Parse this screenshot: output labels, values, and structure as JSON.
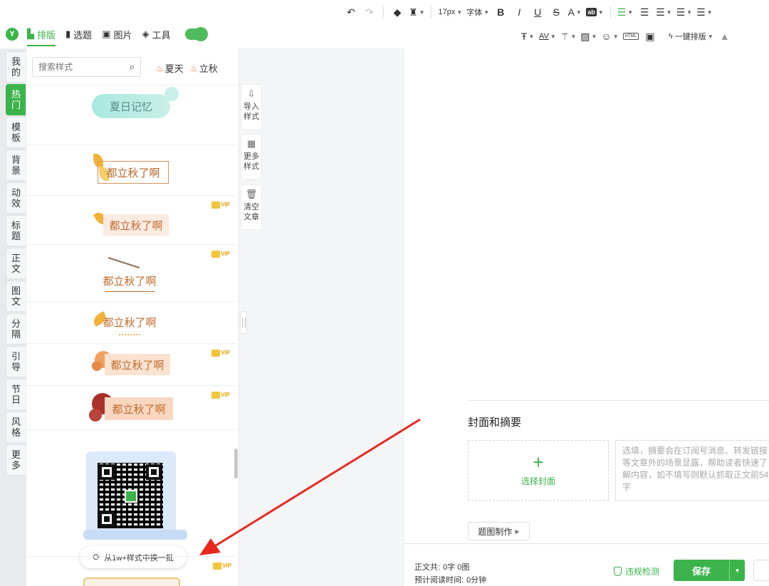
{
  "toolbar": {
    "font_size": "17px",
    "font_label": "字体",
    "bold": "B",
    "italic": "I",
    "underline": "U",
    "strike": "S",
    "color": "A",
    "highlight": "ab",
    "letter_spacing": "AV",
    "html_label": "HTML",
    "one_key_layout": "一键排版"
  },
  "nav": {
    "logo": "Y",
    "items": [
      {
        "label": "排版",
        "icon": "layout-icon"
      },
      {
        "label": "选题",
        "icon": "bookmark-icon"
      },
      {
        "label": "图片",
        "icon": "image-icon"
      },
      {
        "label": "工具",
        "icon": "cube-icon"
      }
    ]
  },
  "categories": [
    {
      "l1": "我",
      "l2": "的"
    },
    {
      "l1": "热",
      "l2": "门"
    },
    {
      "l1": "模",
      "l2": "板"
    },
    {
      "l1": "背",
      "l2": "景"
    },
    {
      "l1": "动",
      "l2": "效"
    },
    {
      "l1": "标",
      "l2": "题"
    },
    {
      "l1": "正",
      "l2": "文"
    },
    {
      "l1": "图",
      "l2": "文"
    },
    {
      "l1": "分",
      "l2": "隔"
    },
    {
      "l1": "引",
      "l2": "导"
    },
    {
      "l1": "节",
      "l2": "日"
    },
    {
      "l1": "风",
      "l2": "格"
    },
    {
      "l1": "更",
      "l2": "多"
    }
  ],
  "panel": {
    "search_placeholder": "搜索样式",
    "tags": [
      "夏天",
      "立秋"
    ],
    "templates": [
      {
        "text": "夏日记忆"
      },
      {
        "text": "都立秋了啊"
      },
      {
        "text": "都立秋了啊"
      },
      {
        "text": "都立秋了啊"
      },
      {
        "text": "都立秋了啊"
      },
      {
        "text": "都立秋了啊"
      },
      {
        "text": "都立秋了啊"
      }
    ],
    "vip_label": "VIP",
    "swap_label": "从1w+样式中换一批"
  },
  "side_buttons": [
    {
      "l1": "导入",
      "l2": "样式"
    },
    {
      "l1": "更多",
      "l2": "样式"
    },
    {
      "l1": "清空",
      "l2": "文章"
    }
  ],
  "editor": {
    "cover_title": "封面和摘要",
    "cover_select": "选择封面",
    "summary_placeholder": "选填，摘要会在订阅号消息、转发链接等文章外的场景显露，帮助读者快速了解内容，如不填写则默认抓取正文前54字",
    "pic_make": "题图制作"
  },
  "bottom": {
    "word_label": "正文共:",
    "word_value": "0字 0图",
    "read_label": "预计阅读时间:",
    "read_value": "0分钟",
    "check_label": "违规检测",
    "save_label": "保存"
  },
  "colors": {
    "accent": "#3cb44b",
    "annotation": "#e8281f"
  }
}
